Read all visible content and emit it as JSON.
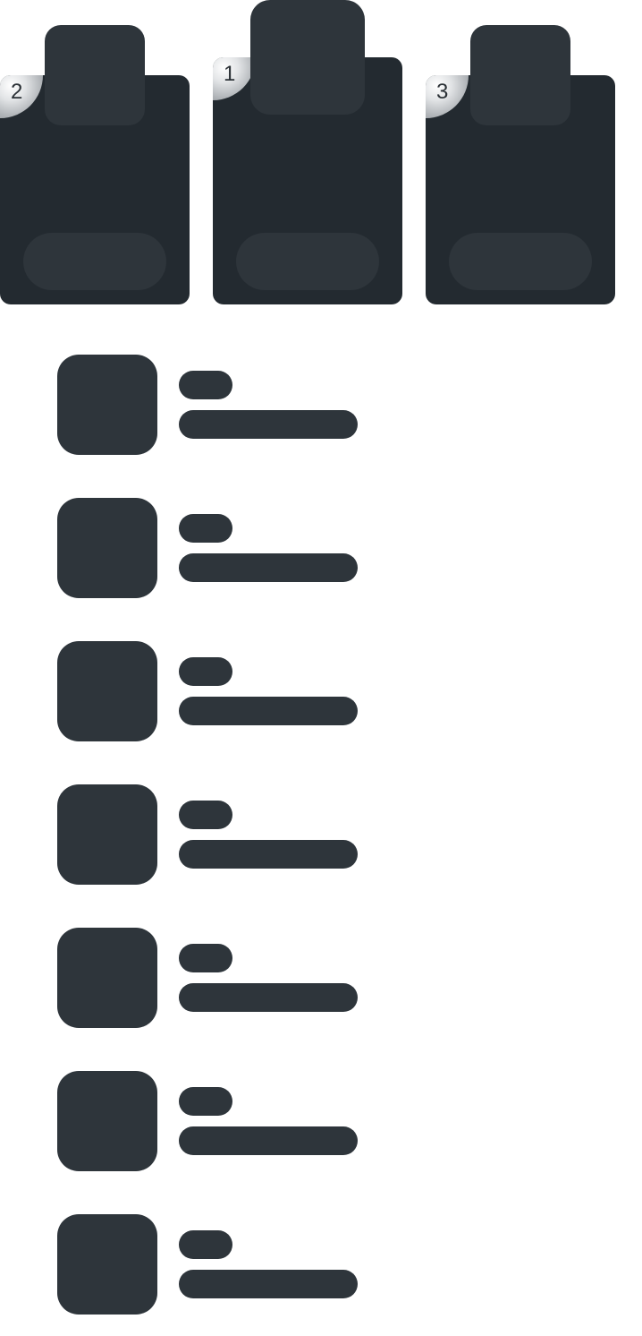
{
  "podium": {
    "entries": [
      {
        "rank": "2"
      },
      {
        "rank": "1"
      },
      {
        "rank": "3"
      }
    ]
  },
  "list": {
    "row_count": 7
  },
  "colors": {
    "card": "#232a30",
    "placeholder": "#2e353b",
    "background": "#ffffff",
    "badge_silver": "#aeb2b6"
  }
}
